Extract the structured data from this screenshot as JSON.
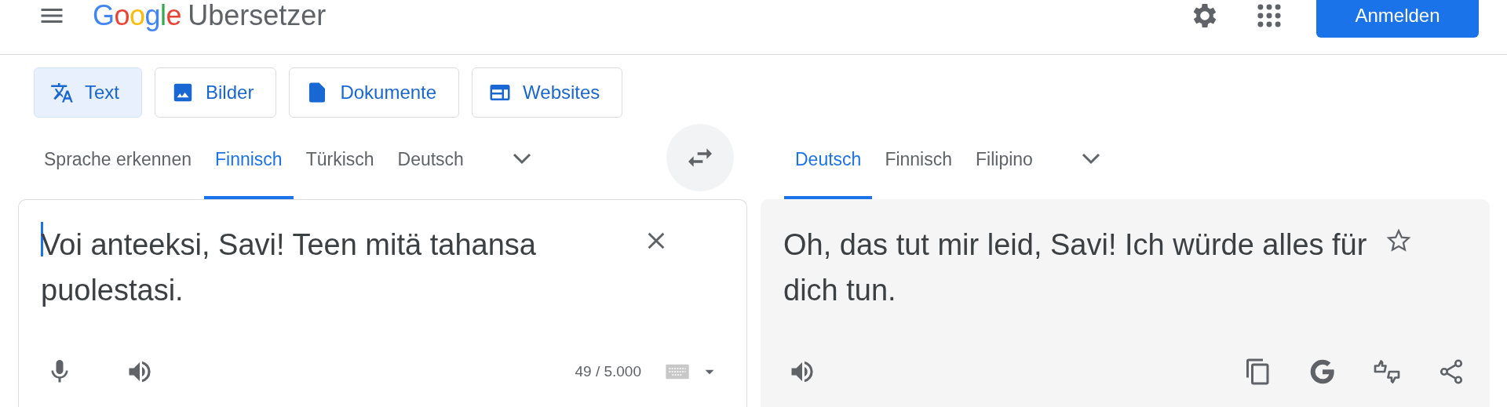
{
  "header": {
    "logo": "Google",
    "app_name": "Ubersetzer",
    "sign_in": "Anmelden"
  },
  "modes": [
    {
      "kind": "text",
      "label": "Text",
      "selected": true
    },
    {
      "kind": "images",
      "label": "Bilder",
      "selected": false
    },
    {
      "kind": "documents",
      "label": "Dokumente",
      "selected": false
    },
    {
      "kind": "websites",
      "label": "Websites",
      "selected": false
    }
  ],
  "source": {
    "languages": [
      {
        "label": "Sprache erkennen",
        "selected": false
      },
      {
        "label": "Finnisch",
        "selected": true
      },
      {
        "label": "Türkisch",
        "selected": false
      },
      {
        "label": "Deutsch",
        "selected": false
      }
    ],
    "text": "Voi anteeksi, Savi! Teen mitä tahansa puolestasi.",
    "char_count": "49 / 5.000"
  },
  "target": {
    "languages": [
      {
        "label": "Deutsch",
        "selected": true
      },
      {
        "label": "Finnisch",
        "selected": false
      },
      {
        "label": "Filipino",
        "selected": false
      }
    ],
    "text": "Oh, das tut mir leid, Savi! Ich würde alles für dich tun."
  }
}
